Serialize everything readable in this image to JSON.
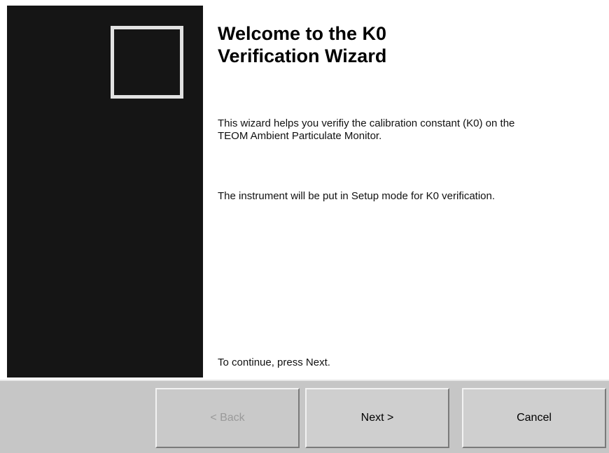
{
  "wizard": {
    "title": "Welcome to the K0 Verification Wizard",
    "paragraph1": "This wizard helps you verifiy the calibration constant (K0) on the TEOM Ambient Particulate Monitor.",
    "paragraph2": "The instrument will be put in Setup mode for K0 verification.",
    "continue_text": "To continue, press Next."
  },
  "buttons": {
    "back_label": "< Back",
    "next_label": "Next >",
    "cancel_label": "Cancel",
    "back_enabled": false
  },
  "colors": {
    "left_panel": "#151515",
    "button_bar": "#c6c6c6",
    "disabled_text": "#9a9a9a"
  }
}
